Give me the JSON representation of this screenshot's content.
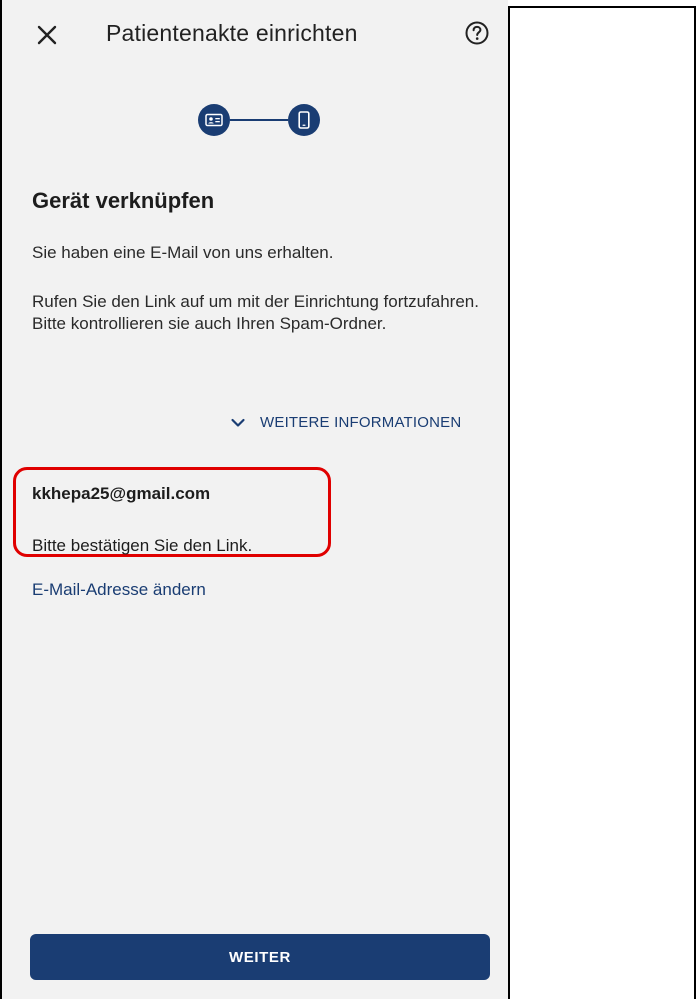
{
  "appbar": {
    "title": "Patientenakte einrichten",
    "close_icon": "close-icon",
    "help_icon": "help-circle-icon"
  },
  "stepper": {
    "steps": [
      {
        "icon": "id-card-icon",
        "state": "done"
      },
      {
        "icon": "smartphone-icon",
        "state": "active"
      }
    ]
  },
  "content": {
    "heading": "Gerät verknüpfen",
    "email_sent_text": "Sie haben eine E-Mail von uns erhalten.",
    "instructions_text": "Rufen Sie den Link auf um mit der Einrichtung fortzufahren. Bitte kontrollieren sie auch Ihren Spam-Ordner.",
    "more_info_label": "WEITERE INFORMATIONEN",
    "email_address": "kkhepa25@gmail.com",
    "confirm_text": "Bitte bestätigen Sie den Link.",
    "change_email_label": "E-Mail-Adresse ändern"
  },
  "footer": {
    "continue_label": "WEITER"
  },
  "colors": {
    "primary": "#1a3d73",
    "background": "#f2f2f2",
    "highlight": "#e00000"
  }
}
